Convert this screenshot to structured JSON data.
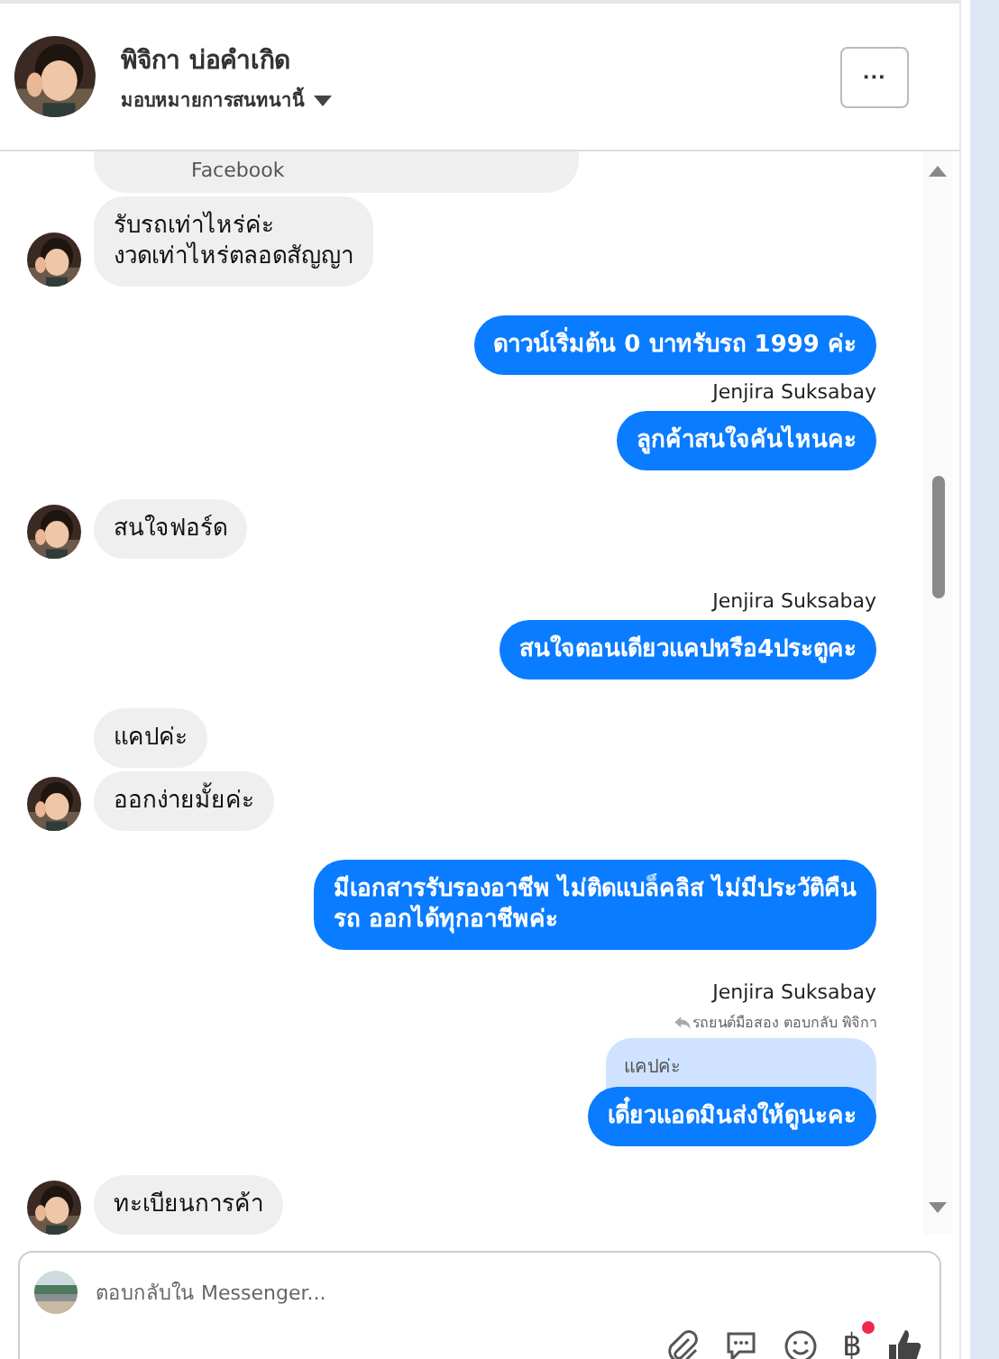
{
  "header": {
    "name": "พิจิกา บ่อคำเกิด",
    "assign": "มอบหมายการสนทนานี้",
    "more": "···"
  },
  "groups": [
    {
      "kind": "incoming",
      "items": [
        {
          "kind": "bubble",
          "text": "Facebook"
        },
        {
          "kind": "bubble",
          "text": "รับรถเท่าไหร่ค่ะ\nงวดเท่าไหร่ตลอดสัญญา"
        }
      ]
    },
    {
      "kind": "outgoing",
      "items": [
        {
          "kind": "bubble",
          "text": "ดาวน์เริ่มต้น 0 บาทรับรถ 1999 ค่ะ"
        },
        {
          "kind": "sender",
          "text": "Jenjira Suksabay"
        },
        {
          "kind": "bubble",
          "text": "ลูกค้าสนใจคันไหนคะ"
        }
      ]
    },
    {
      "kind": "incoming",
      "items": [
        {
          "kind": "bubble",
          "text": "สนใจฟอร์ด"
        }
      ]
    },
    {
      "kind": "outgoing",
      "items": [
        {
          "kind": "sender",
          "text": "Jenjira Suksabay"
        },
        {
          "kind": "bubble",
          "text": "สนใจตอนเดียวแคปหรือ4ประตูคะ"
        }
      ]
    },
    {
      "kind": "incoming",
      "items": [
        {
          "kind": "bubble",
          "text": "แคปค่ะ"
        },
        {
          "kind": "bubble",
          "text": "ออกง่ายมั้ยค่ะ"
        }
      ]
    },
    {
      "kind": "outgoing",
      "items": [
        {
          "kind": "bubble",
          "text": "มีเอกสารรับรองอาชีพ ไม่ติดแบล็คลิส ไม่มีประวัติคืน\nรถ ออกได้ทุกอาชีพค่ะ"
        }
      ]
    },
    {
      "kind": "outgoing",
      "items": [
        {
          "kind": "sender",
          "text": "Jenjira Suksabay"
        },
        {
          "kind": "reply-note",
          "text": "รถยนต์มือสอง ตอบกลับ พิจิกา"
        },
        {
          "kind": "quote",
          "text": "แคปค่ะ"
        },
        {
          "kind": "bubble",
          "text": "เดี๋ยวแอดมินส่งให้ดูนะคะ"
        }
      ]
    },
    {
      "kind": "incoming",
      "items": [
        {
          "kind": "bubble",
          "text": "ทะเบียนการค้า"
        }
      ]
    }
  ],
  "composer": {
    "placeholder": "ตอบกลับใน Messenger...",
    "currency": "฿",
    "currency_badge": true
  }
}
